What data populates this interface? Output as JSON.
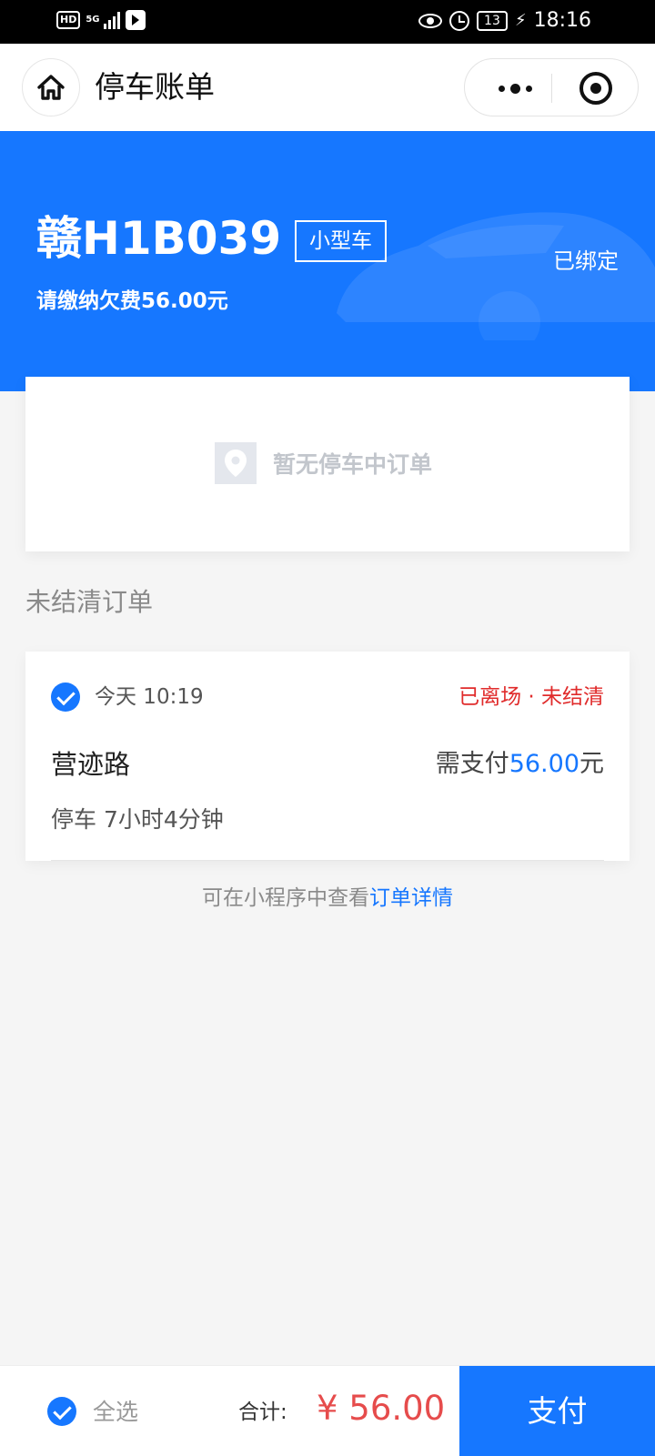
{
  "status_bar": {
    "hd": "HD",
    "network": "5G",
    "battery": "13",
    "time": "18:16"
  },
  "nav": {
    "title": "停车账单"
  },
  "vehicle": {
    "plate": "赣H1B039",
    "type": "小型车",
    "owe_text": "请缴纳欠费56.00元",
    "bound": "已绑定"
  },
  "parking": {
    "empty_text": "暂无停车中订单"
  },
  "unpaid": {
    "title": "未结清订单",
    "order": {
      "time": "今天 10:19",
      "status": "已离场 · 未结清",
      "place": "营迹路",
      "pay_prefix": "需支付",
      "pay_amount": "56.00",
      "pay_unit": "元",
      "duration": "停车 7小时4分钟"
    }
  },
  "tip": {
    "prefix": "可在小程序中查看",
    "link": "订单详情"
  },
  "footer": {
    "select_all": "全选",
    "total_label": "合计:",
    "total_amount": "¥ 56.00",
    "pay_label": "支付"
  },
  "colors": {
    "primary": "#1677ff",
    "danger": "#e02b2b",
    "amount": "#e64c4c"
  }
}
